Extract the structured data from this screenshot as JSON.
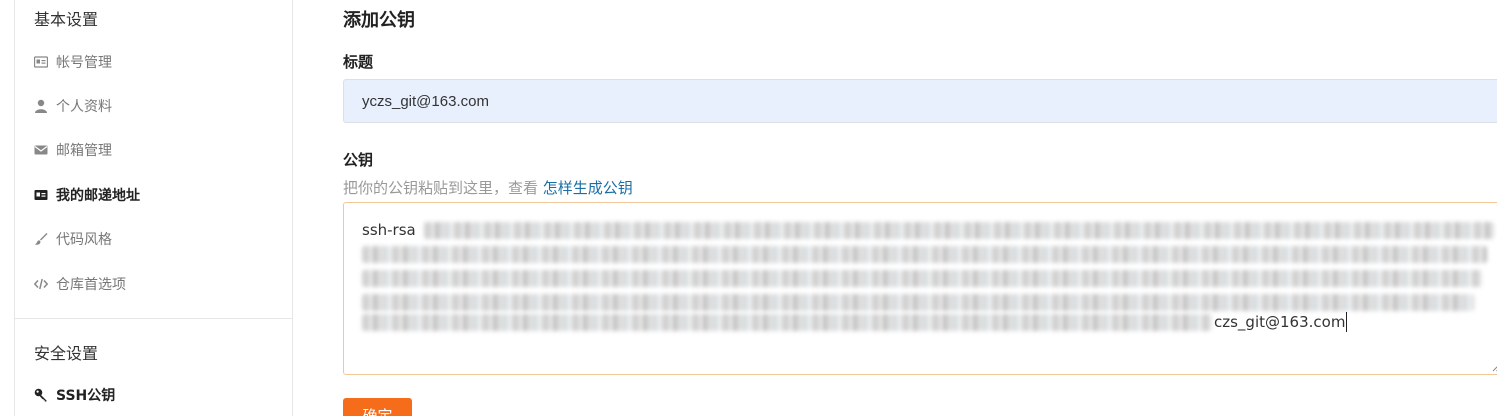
{
  "sidebar": {
    "basic_header": "基本设置",
    "basic_items": [
      {
        "label": "帐号管理",
        "icon": "id-card-icon"
      },
      {
        "label": "个人资料",
        "icon": "user-icon"
      },
      {
        "label": "邮箱管理",
        "icon": "envelope-icon"
      },
      {
        "label": "我的邮递地址",
        "icon": "address-card-icon"
      },
      {
        "label": "代码风格",
        "icon": "paint-brush-icon"
      },
      {
        "label": "仓库首选项",
        "icon": "code-icon"
      }
    ],
    "security_header": "安全设置",
    "security_items": [
      {
        "label": "SSH公钥",
        "icon": "key-icon"
      }
    ]
  },
  "main": {
    "page_title": "添加公钥",
    "title_label": "标题",
    "title_value": "yczs_git@163.com",
    "key_label": "公钥",
    "hint_text": "把你的公钥粘贴到这里，查看 ",
    "hint_link": "怎样生成公钥",
    "key_prefix": "ssh-rsa",
    "key_suffix": "czs_git@163.com",
    "submit_label": "确定"
  },
  "colors": {
    "accent": "#f56c1a",
    "link": "#1a6fa6",
    "input_bg": "#e8f0fe",
    "textarea_border": "#f2c89a"
  }
}
